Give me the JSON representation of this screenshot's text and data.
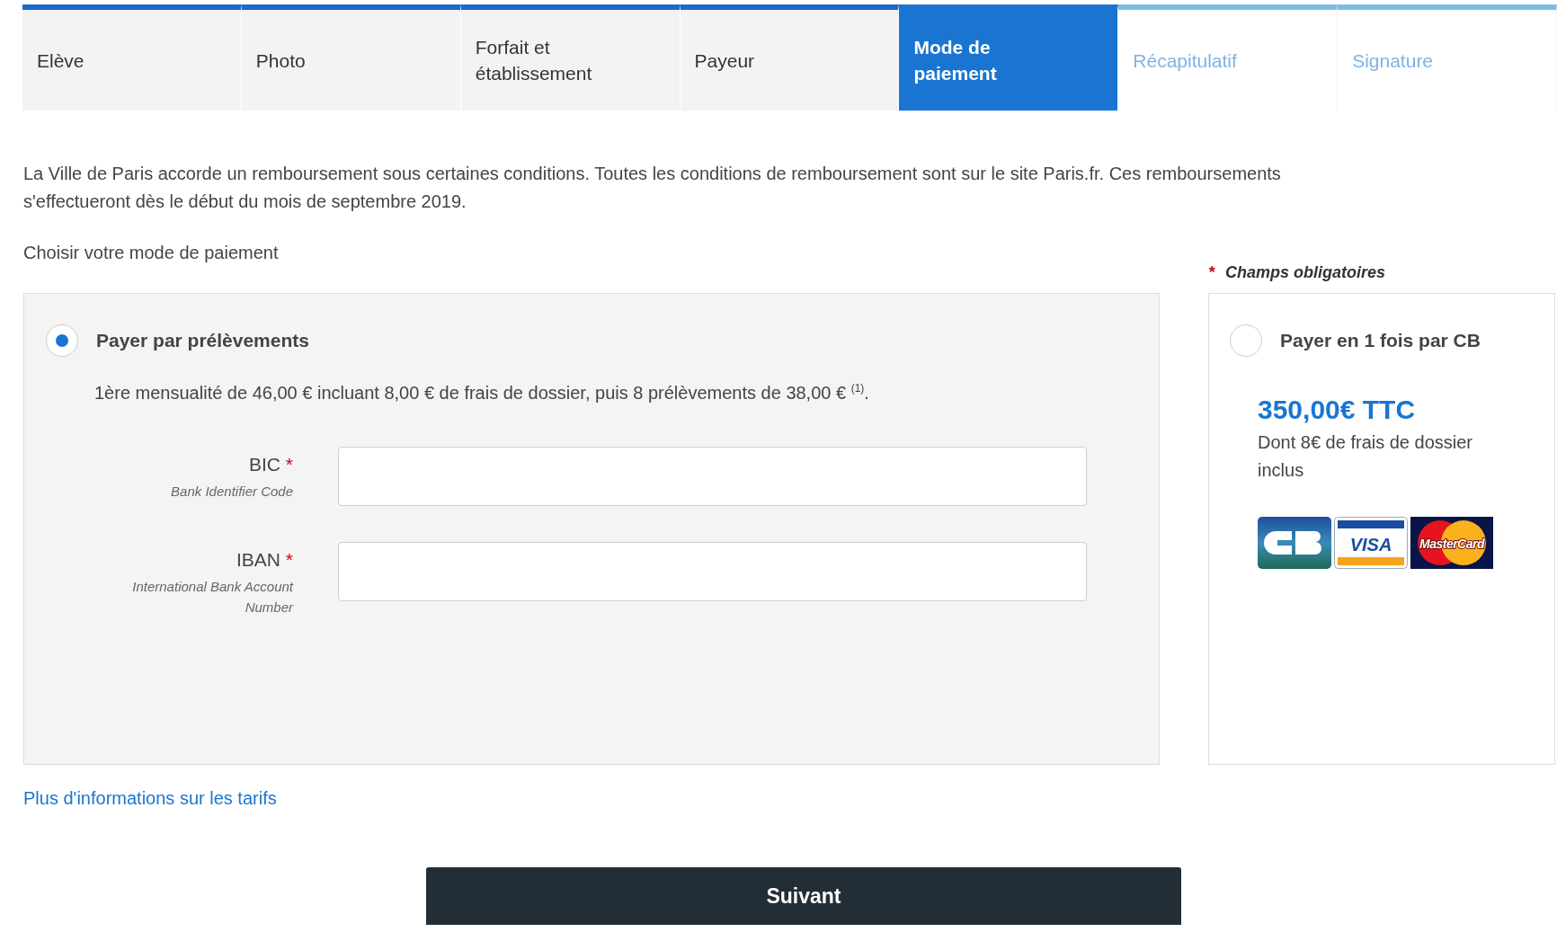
{
  "steps": [
    {
      "label": "Elève",
      "completed": true,
      "selected": false
    },
    {
      "label": "Photo",
      "completed": true,
      "selected": false
    },
    {
      "label": "Forfait et établissement",
      "completed": true,
      "selected": false
    },
    {
      "label": "Payeur",
      "completed": true,
      "selected": false
    },
    {
      "label": "Mode de paiement",
      "completed": false,
      "selected": true
    },
    {
      "label": "Récapitulatif",
      "completed": false,
      "selected": false
    },
    {
      "label": "Signature",
      "completed": false,
      "selected": false
    }
  ],
  "intro": "La Ville de Paris accorde un remboursement sous certaines conditions. Toutes les conditions de remboursement sont sur le site Paris.fr. Ces remboursements s'effectueront dès le début du mois de septembre 2019.",
  "prompt": "Choisir votre mode de paiement",
  "required_note": {
    "mark": "*",
    "text": "Champs obligatoires"
  },
  "debit_option": {
    "label": "Payer par prélèvements",
    "selected": true,
    "details": "1ère mensualité de 46,00 € incluant 8,00 € de frais de dossier, puis 8 prélèvements de 38,00 € $^{(1)}$.",
    "fields": [
      {
        "label": "BIC",
        "mark": "*",
        "hint": "Bank Identifier Code"
      },
      {
        "label": "IBAN",
        "mark": "*",
        "hint": "International Bank Account Number"
      }
    ]
  },
  "card_option": {
    "label": "Payer en 1 fois par CB",
    "selected": false,
    "price": "350,00€ TTC",
    "note": "Dont 8€ de frais de dossier inclus",
    "logos": [
      {
        "kind": "cb"
      },
      {
        "kind": "visa",
        "text": "VISA"
      },
      {
        "kind": "mastercard",
        "text": "MasterCard"
      }
    ]
  },
  "tariff_link": "Plus d'informations sur les tarifs",
  "next_button": "Suivant"
}
